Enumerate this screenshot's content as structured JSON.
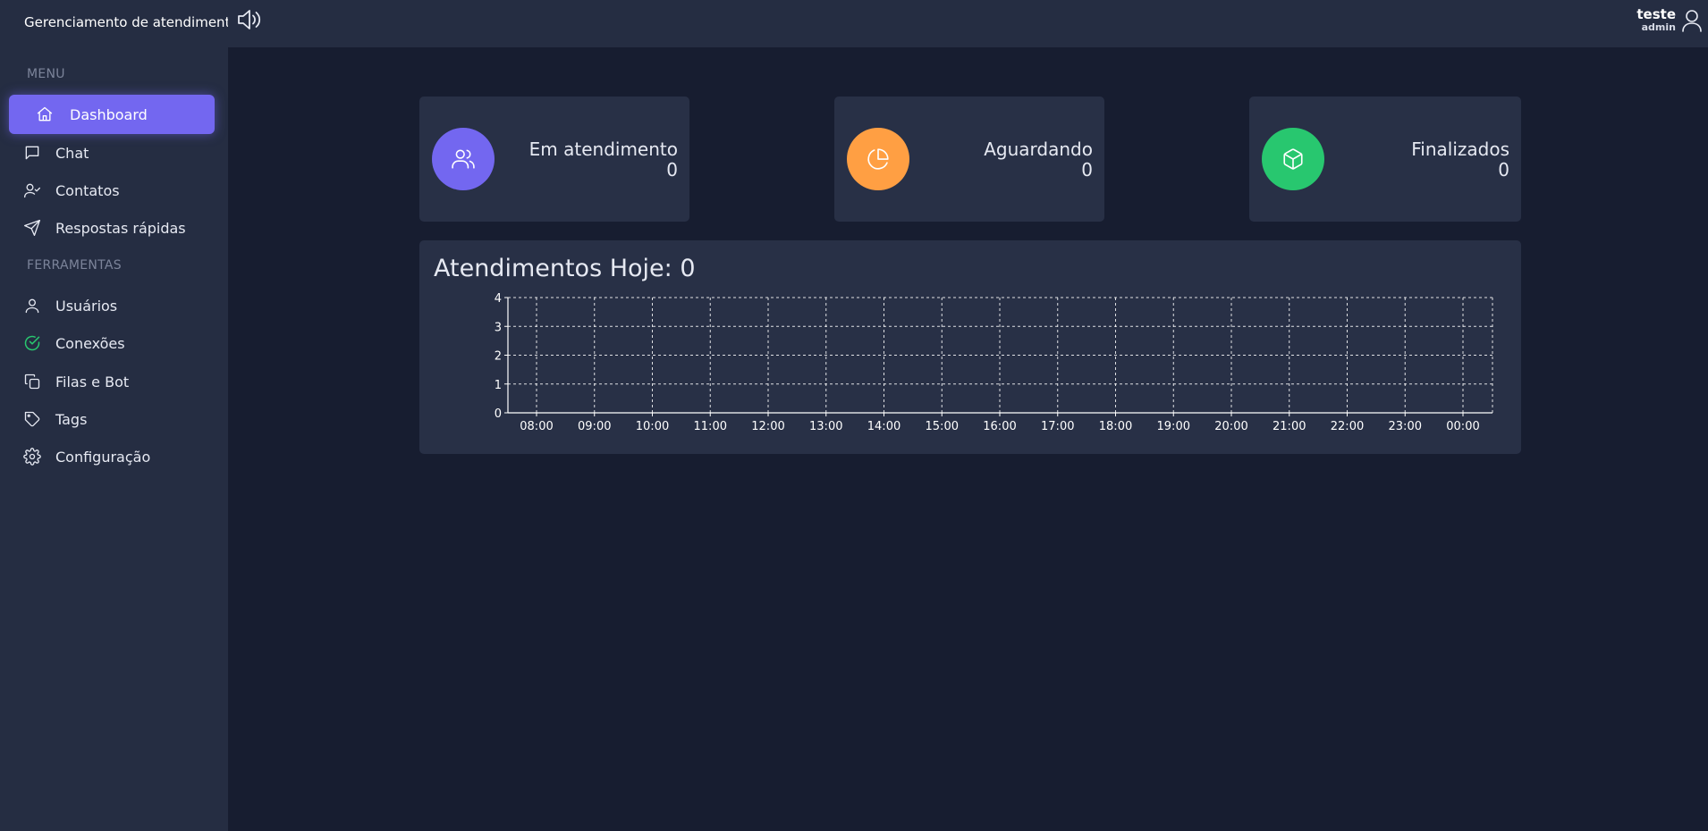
{
  "app": {
    "title": "Gerenciamento de atendimento"
  },
  "topbar": {
    "sound_icon": "volume-icon",
    "user_name": "teste",
    "user_role": "admin",
    "user_icon": "user-icon"
  },
  "sidebar": {
    "menu_label": "MENU",
    "tools_label": "FERRAMENTAS",
    "items": [
      {
        "label": "Dashboard",
        "icon": "home-icon",
        "active": true
      },
      {
        "label": "Chat",
        "icon": "message-icon",
        "active": false
      },
      {
        "label": "Contatos",
        "icon": "user-check-icon",
        "active": false
      },
      {
        "label": "Respostas rápidas",
        "icon": "send-icon",
        "active": false
      }
    ],
    "tools": [
      {
        "label": "Usuários",
        "icon": "user-icon"
      },
      {
        "label": "Conexões",
        "icon": "check-circle-icon"
      },
      {
        "label": "Filas e Bot",
        "icon": "copy-icon"
      },
      {
        "label": "Tags",
        "icon": "tag-icon"
      },
      {
        "label": "Configuração",
        "icon": "settings-icon"
      }
    ]
  },
  "cards": [
    {
      "label": "Em atendimento",
      "value": "0",
      "color": "#7367f0",
      "icon": "users-icon"
    },
    {
      "label": "Aguardando",
      "value": "0",
      "color": "#ff9f43",
      "icon": "pie-chart-icon"
    },
    {
      "label": "Finalizados",
      "value": "0",
      "color": "#28c76f",
      "icon": "box-icon"
    }
  ],
  "chart": {
    "title": "Atendimentos Hoje: 0"
  },
  "chart_data": {
    "type": "bar",
    "title": "Atendimentos Hoje: 0",
    "categories": [
      "08:00",
      "09:00",
      "10:00",
      "11:00",
      "12:00",
      "13:00",
      "14:00",
      "15:00",
      "16:00",
      "17:00",
      "18:00",
      "19:00",
      "20:00",
      "21:00",
      "22:00",
      "23:00",
      "00:00"
    ],
    "values": [
      0,
      0,
      0,
      0,
      0,
      0,
      0,
      0,
      0,
      0,
      0,
      0,
      0,
      0,
      0,
      0,
      0
    ],
    "yticks": [
      0,
      1,
      2,
      3,
      4
    ],
    "ylim": [
      0,
      4
    ],
    "xlabel": "",
    "ylabel": "",
    "grid": true
  },
  "colors": {
    "accent": "#7367f0",
    "sidebar_bg": "#252d42",
    "page_bg": "#171d30",
    "card_bg": "#283046",
    "success": "#28c76f"
  }
}
